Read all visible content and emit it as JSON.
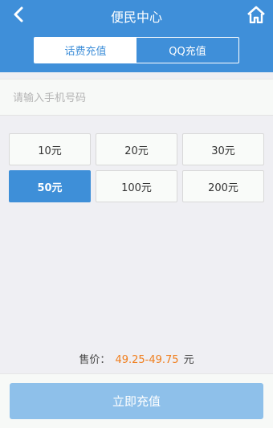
{
  "header": {
    "title": "便民中心",
    "back_icon": "chevron-left-icon",
    "home_icon": "home-icon",
    "tabs": [
      {
        "label": "话费充值",
        "active": true
      },
      {
        "label": "QQ充值",
        "active": false
      }
    ]
  },
  "phone": {
    "placeholder": "请输入手机号码",
    "value": ""
  },
  "amounts": [
    {
      "label": "10元",
      "selected": false
    },
    {
      "label": "20元",
      "selected": false
    },
    {
      "label": "30元",
      "selected": false
    },
    {
      "label": "50元",
      "selected": true
    },
    {
      "label": "100元",
      "selected": false
    },
    {
      "label": "200元",
      "selected": false
    }
  ],
  "price": {
    "label": "售价：",
    "value": "49.25-49.75",
    "unit": "元"
  },
  "submit": {
    "label": "立即充值"
  },
  "colors": {
    "primary": "#3f8fd9",
    "price": "#f07e1c",
    "submit_disabled": "#8ec0ea"
  }
}
